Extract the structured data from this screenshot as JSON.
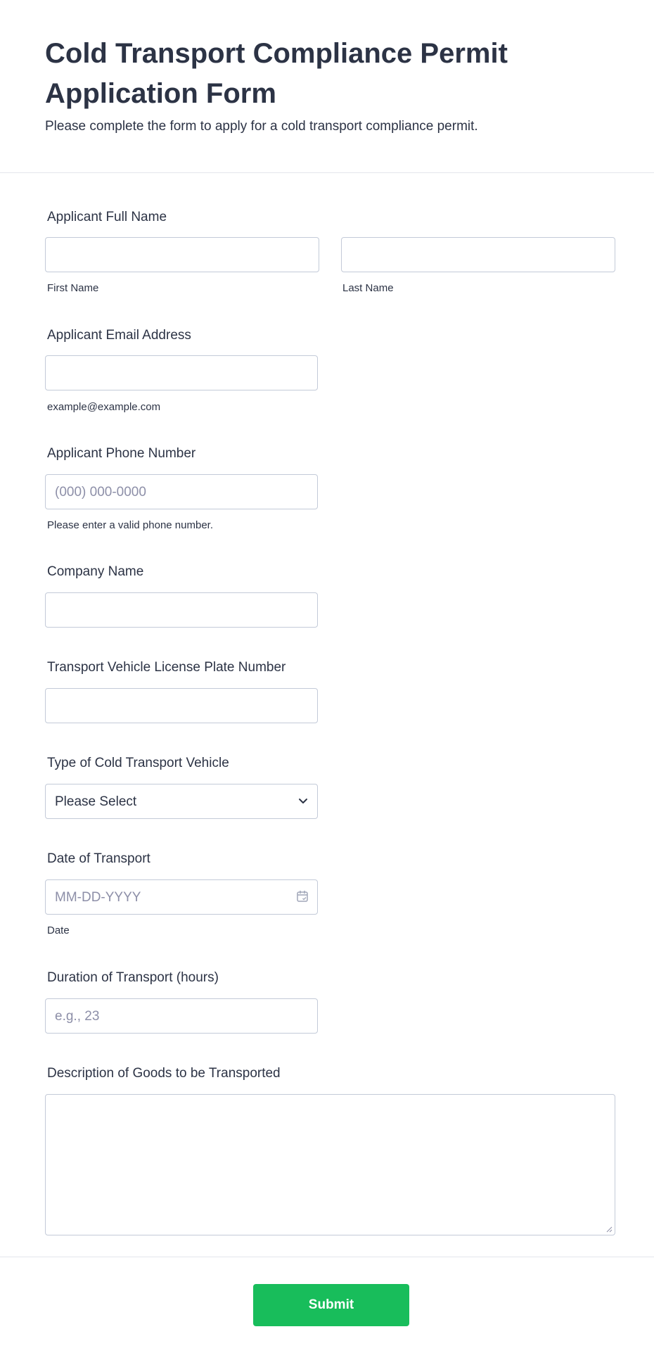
{
  "header": {
    "title": "Cold Transport Compliance Permit Application Form",
    "subtitle": "Please complete the form to apply for a cold transport compliance permit."
  },
  "fields": {
    "full_name": {
      "label": "Applicant Full Name",
      "first_sublabel": "First Name",
      "last_sublabel": "Last Name",
      "first_value": "",
      "last_value": ""
    },
    "email": {
      "label": "Applicant Email Address",
      "sublabel": "example@example.com",
      "value": ""
    },
    "phone": {
      "label": "Applicant Phone Number",
      "placeholder": "(000) 000-0000",
      "sublabel": "Please enter a valid phone number."
    },
    "company": {
      "label": "Company Name",
      "value": ""
    },
    "plate": {
      "label": "Transport Vehicle License Plate Number",
      "value": ""
    },
    "vehicle_type": {
      "label": "Type of Cold Transport Vehicle",
      "selected": "Please Select"
    },
    "date": {
      "label": "Date of Transport",
      "placeholder": "MM-DD-YYYY",
      "sublabel": "Date"
    },
    "duration": {
      "label": "Duration of Transport (hours)",
      "placeholder": "e.g., 23"
    },
    "description": {
      "label": "Description of Goods to be Transported",
      "value": ""
    }
  },
  "submit": {
    "label": "Submit"
  },
  "colors": {
    "text": "#2c3345",
    "border": "#c3cad8",
    "placeholder": "#8d8fa8",
    "submit": "#18bd5b",
    "divider": "#e4e6ec"
  },
  "icons": {
    "select": "chevron-down-icon",
    "date": "calendar-icon",
    "textarea": "resize-handle-icon"
  }
}
